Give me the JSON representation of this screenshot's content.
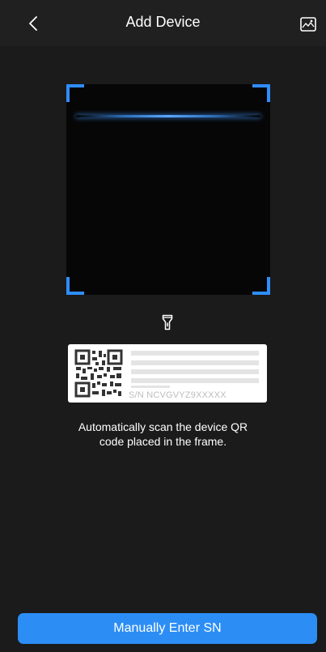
{
  "header": {
    "title": "Add Device",
    "back_icon": "chevron-left-icon",
    "gallery_icon": "image-icon"
  },
  "scanner": {
    "accent_color": "#2f8dff",
    "flashlight_icon": "flashlight-icon"
  },
  "sample_label": {
    "sn_text": "S/N  NCVGVYZ9XXXXX"
  },
  "instruction": {
    "line1": "Automatically scan the device QR",
    "line2": "code placed in the frame."
  },
  "footer": {
    "manual_button_label": "Manually Enter SN",
    "button_color": "#2c8ef5"
  }
}
